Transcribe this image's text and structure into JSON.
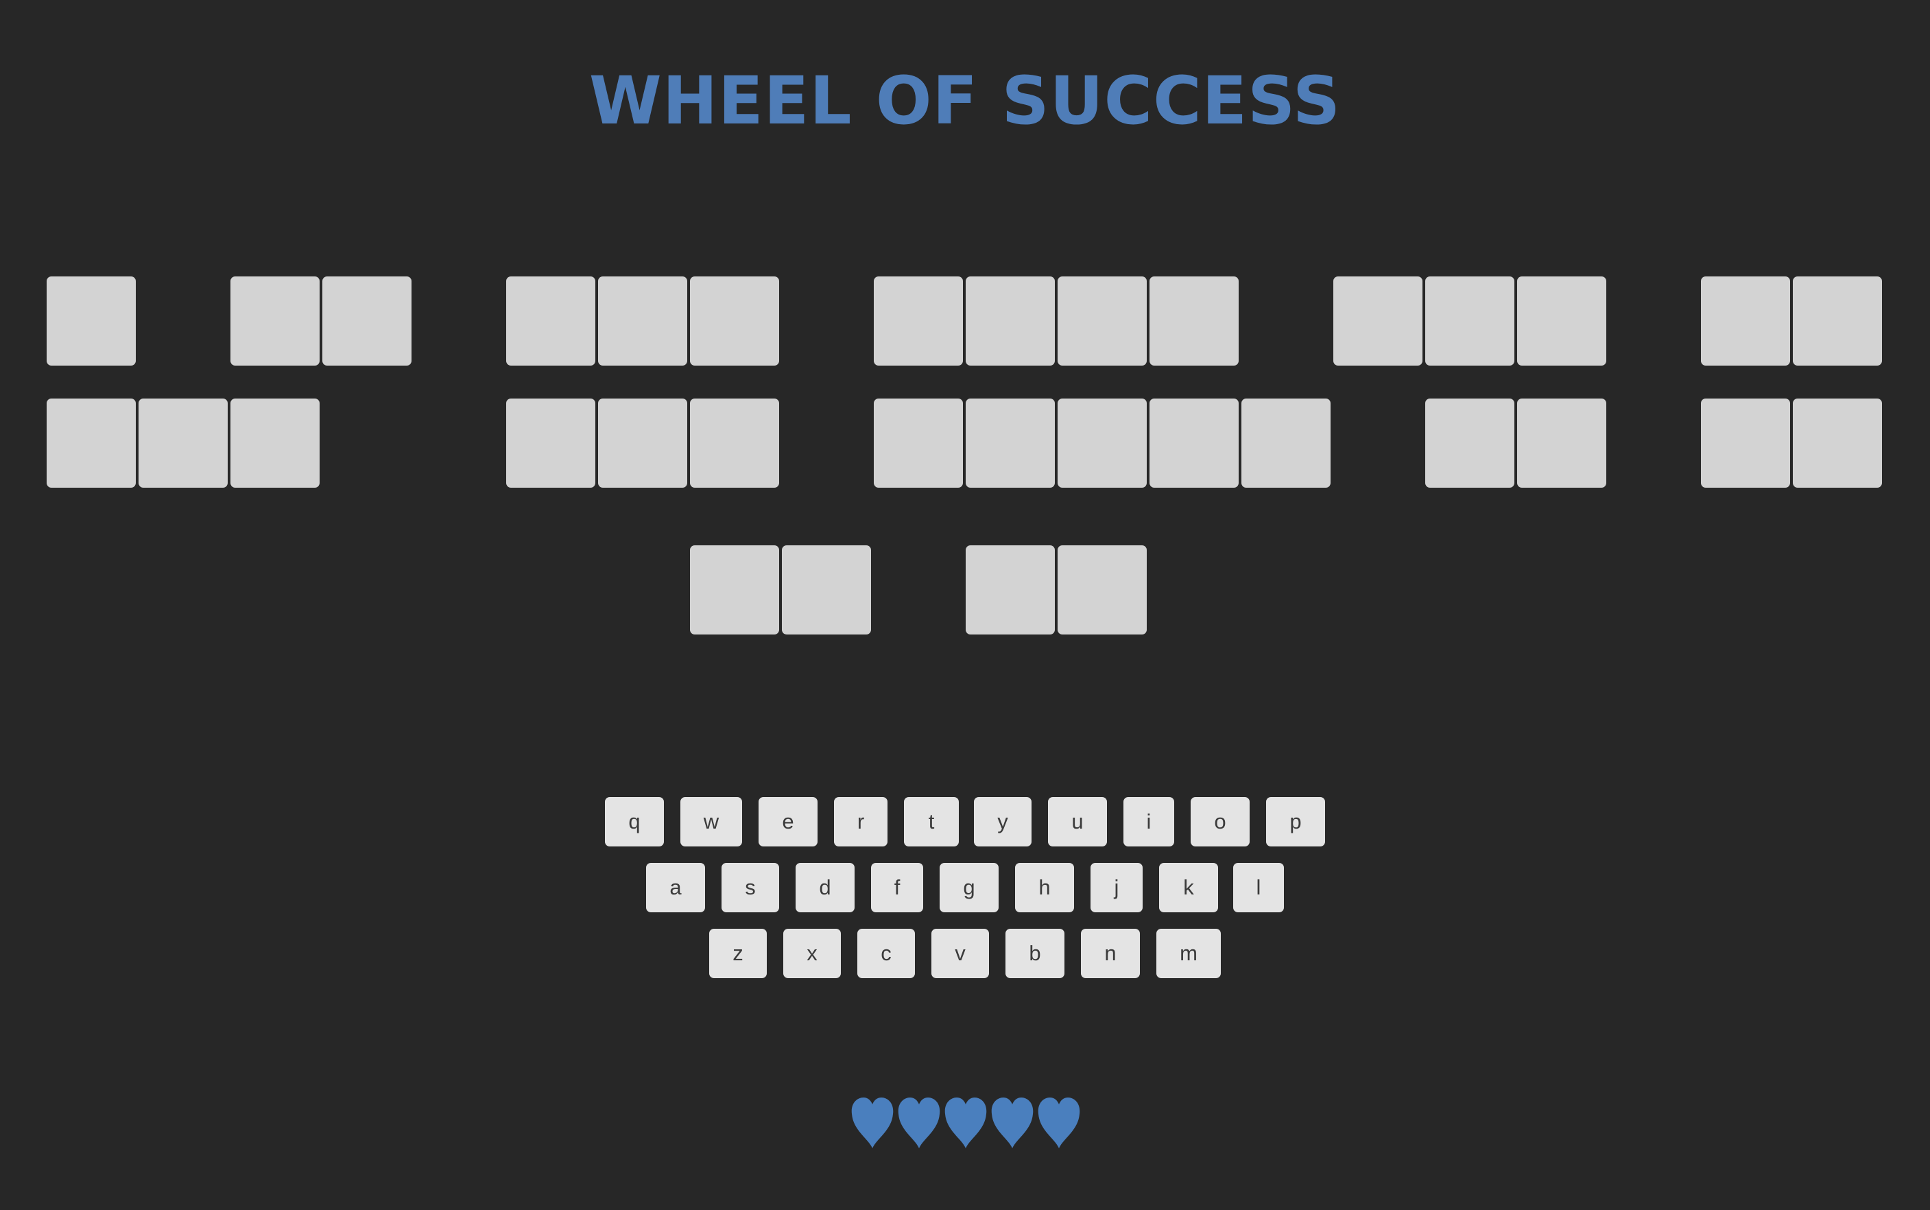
{
  "header": {
    "title": "WHEEL OF SUCCESS"
  },
  "phrase": {
    "rows": [
      [
        1,
        2,
        3,
        4,
        3,
        2
      ],
      [
        3,
        3,
        5,
        2,
        2
      ],
      [
        2,
        2
      ]
    ],
    "revealed_letters": []
  },
  "keyboard": {
    "rows": [
      [
        "q",
        "w",
        "e",
        "r",
        "t",
        "y",
        "u",
        "i",
        "o",
        "p"
      ],
      [
        "a",
        "s",
        "d",
        "f",
        "g",
        "h",
        "j",
        "k",
        "l"
      ],
      [
        "z",
        "x",
        "c",
        "v",
        "b",
        "n",
        "m"
      ]
    ]
  },
  "lives": {
    "remaining": 5,
    "total": 5
  },
  "colors": {
    "accent": "#4f7db8",
    "heart": "#4a7fbe",
    "background": "#272727",
    "tile": "#d3d3d3",
    "key": "#e4e4e4"
  },
  "icons": {
    "life": "heart-icon"
  }
}
